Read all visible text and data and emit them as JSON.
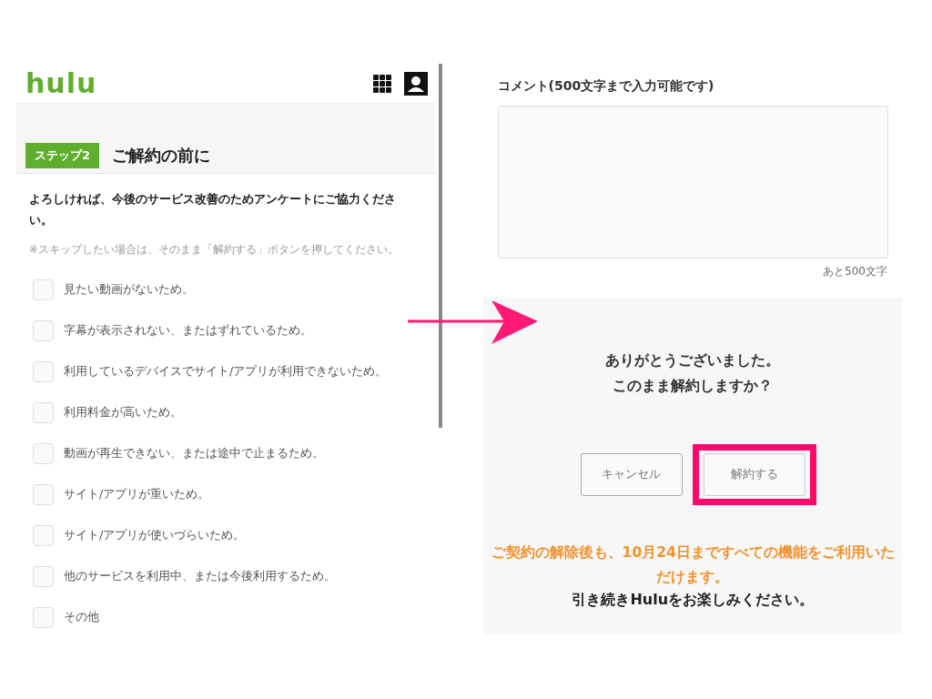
{
  "left_screen": {
    "logo": "hulu",
    "step": {
      "badge": "ステップ2",
      "title": "ご解約の前に"
    },
    "intro": "よろしければ、今後のサービス改善のためアンケートにご協力ください。",
    "note": "※スキップしたい場合は、そのまま「解約する」ボタンを押してください。",
    "reasons": [
      {
        "label": "見たい動画がないため。",
        "checked": false
      },
      {
        "label": "字幕が表示されない、またはずれているため。",
        "checked": false
      },
      {
        "label": "利用しているデバイスでサイト/アプリが利用できないため。",
        "checked": false
      },
      {
        "label": "利用料金が高いため。",
        "checked": false
      },
      {
        "label": "動画が再生できない、または途中で止まるため。",
        "checked": false
      },
      {
        "label": "サイト/アプリが重いため。",
        "checked": false
      },
      {
        "label": "サイト/アプリが使いづらいため。",
        "checked": false
      },
      {
        "label": "他のサービスを利用中、または今後利用するため。",
        "checked": false
      },
      {
        "label": "その他",
        "checked": false
      }
    ]
  },
  "right_screen": {
    "comment_label": "コメント(500文字まで入力可能です)",
    "counter": "あと500文字",
    "thanks": [
      "ありがとうございました。",
      "このまま解約しますか？"
    ],
    "buttons": [
      {
        "label": "キャンセル",
        "highlighted": false
      },
      {
        "label": "解約する",
        "highlighted": true
      }
    ],
    "notice": "ご契約の解除後も、10月24日まですべての機能をご利用いただけます。",
    "closing": "引き続きHuluをお楽しみください。"
  }
}
